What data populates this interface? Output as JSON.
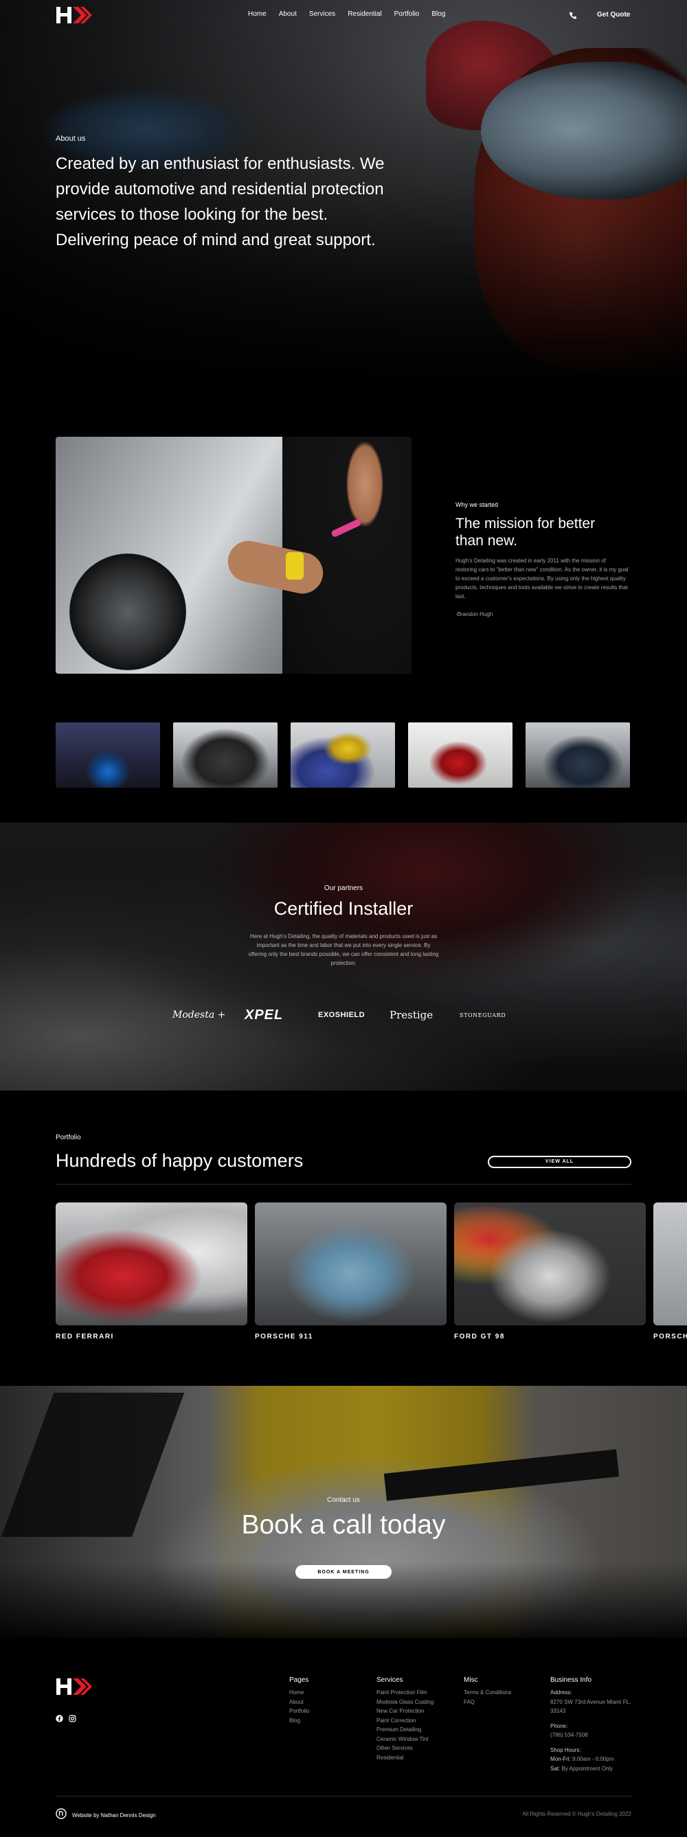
{
  "nav": {
    "logo": "logo-icon",
    "links": [
      "Home",
      "About",
      "Services",
      "Residential",
      "Portfolio",
      "Blog"
    ],
    "phone_icon": "phone-icon",
    "cta_label": "Get Quote"
  },
  "hero": {
    "eyebrow": "About us",
    "title": "Created by an enthusiast for enthusiasts. We provide automotive and residential protection services to those looking for the best. Delivering peace of mind and great support."
  },
  "mission": {
    "eyebrow": "Why we started",
    "title": "The mission for better than new.",
    "body": "Hugh's Detailing was created in early 2011 with the mission of restoring cars to \"better than new\" condition. As the owner, it is my goal to exceed a customer's expectations. By using only the highest quality products, techniques and tools available we strive to create results that last.",
    "signature": "-Brandon Hugh"
  },
  "partners": {
    "eyebrow": "Our partners",
    "title": "Certified Installer",
    "body": "Here at Hugh's Detailing, the quality of materials and products used is just as important as the time and labor that we put into every single service. By offering only the best brands possible, we can offer consistent and long lasting protection.",
    "brands": [
      "Modesta +",
      "XPEL",
      "EXOSHIELD",
      "Prestige",
      "STONEGUARD"
    ]
  },
  "portfolio": {
    "eyebrow": "Portfolio",
    "title": "Hundreds of happy customers",
    "view_all": "VIEW ALL",
    "cards": [
      {
        "label": "RED FERRARI"
      },
      {
        "label": "PORSCHE 911"
      },
      {
        "label": "FORD GT 98"
      },
      {
        "label": "PORSCH"
      }
    ]
  },
  "book": {
    "eyebrow": "Contact us",
    "title": "Book a call today",
    "button": "BOOK A MEETING"
  },
  "footer": {
    "social_icons": [
      "facebook-icon",
      "instagram-icon"
    ],
    "pages": {
      "heading": "Pages",
      "links": [
        "Home",
        "About",
        "Portfolio",
        "Blog"
      ]
    },
    "services": {
      "heading": "Services",
      "links": [
        "Paint Protection Film",
        "Modesta Glass Coating",
        "New Car Protection",
        "Paint Correction",
        "Premium Detailing",
        "Ceramic Window Tint",
        "Other Services",
        "Residential"
      ]
    },
    "misc": {
      "heading": "Misc",
      "links": [
        "Terms & Conditions",
        "FAQ"
      ]
    },
    "business": {
      "heading": "Business Info",
      "address_label": "Address:",
      "address_line1": "8270 SW 73rd Avenue Miami FL,",
      "address_line2": "33143",
      "phone_label": "Phone:",
      "phone": "(786) 534-7508",
      "hours_label": "Shop Hours:",
      "hours_weekday_day": "Mon-Fri:",
      "hours_weekday": "9:00am - 6:00pm",
      "hours_sat_day": "Sat:",
      "hours_sat": "By Appointment Only"
    },
    "credit": "Website by Nathan Dennis Design",
    "copyright": "All Rights Reserved © Hugh's Detailing 2022"
  },
  "colors": {
    "accent": "#e01e26",
    "background": "#000000",
    "text": "#ffffff",
    "muted": "#9a9a9a"
  }
}
